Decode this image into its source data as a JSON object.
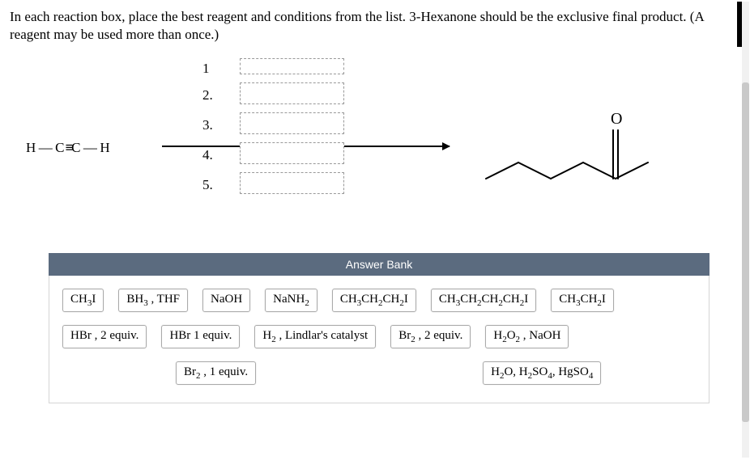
{
  "instructions": "In each reaction box, place the best reagent and conditions from the list. 3-Hexanone should be the exclusive final product. (A reagent may be used more than once.)",
  "startingMaterialAlt": "H—C≡C—H",
  "stepNumbers": [
    "1",
    "2.",
    "3.",
    "4.",
    "5."
  ],
  "productAlt": "3-Hexanone skeletal structure",
  "answerBank": {
    "header": "Answer Bank",
    "rows": [
      [
        "CH3I",
        "BH3_THF",
        "NaOH",
        "NaNH2",
        "CH3CH2CH2I",
        "CH3CH2CH2CH2I",
        "CH3CH2I"
      ],
      [
        "HBr_2equiv",
        "HBr_1equiv",
        "H2_Lindlar",
        "Br2_2equiv",
        "H2O2_NaOH"
      ],
      [
        "Br2_1equiv",
        "H2O_H2SO4_HgSO4"
      ]
    ],
    "labelsHtml": {
      "CH3I": "CH<sub>3</sub>I",
      "BH3_THF": "BH<sub>3</sub> , THF",
      "NaOH": "NaOH",
      "NaNH2": "NaNH<sub>2</sub>",
      "CH3CH2CH2I": "CH<sub>3</sub>CH<sub>2</sub>CH<sub>2</sub>I",
      "CH3CH2CH2CH2I": "CH<sub>3</sub>CH<sub>2</sub>CH<sub>2</sub>CH<sub>2</sub>I",
      "CH3CH2I": "CH<sub>3</sub>CH<sub>2</sub>I",
      "HBr_2equiv": "HBr , 2 equiv.",
      "HBr_1equiv": "HBr 1 equiv.",
      "H2_Lindlar": "H<sub>2</sub> , Lindlar's catalyst",
      "Br2_2equiv": "Br<sub>2</sub> , 2 equiv.",
      "H2O2_NaOH": "H<sub>2</sub>O<sub>2</sub> , NaOH",
      "Br2_1equiv": "Br<sub>2</sub> , 1 equiv.",
      "H2O_H2SO4_HgSO4": "H<sub>2</sub>O, H<sub>2</sub>SO<sub>4</sub>, HgSO<sub>4</sub>"
    }
  }
}
